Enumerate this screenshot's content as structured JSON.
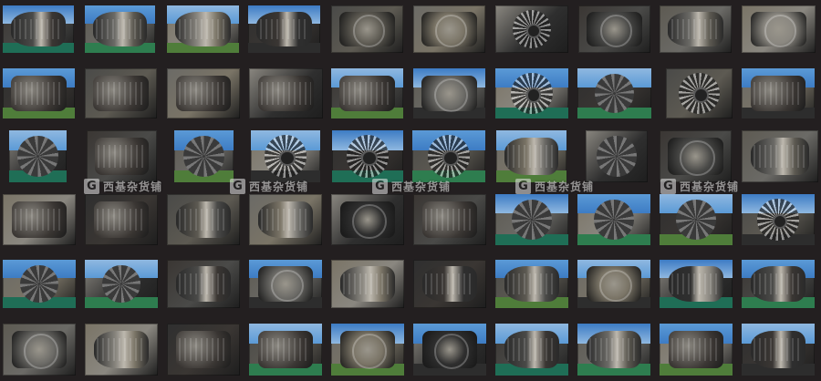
{
  "watermark": {
    "logo_letter": "G",
    "text": "西基杂货铺"
  },
  "palette": {
    "background": "#231f20",
    "sky": [
      "#3d7cc4",
      "#5b9ad6",
      "#8fb8e0"
    ],
    "metal": [
      "#4a4a48",
      "#6b6a66",
      "#8a8780",
      "#3a3633",
      "#5d5a52",
      "#7a7466",
      "#2f2f2f"
    ],
    "ground": [
      "#1f6e56",
      "#2e7d4f",
      "#4f7d3a",
      "#2d2d2d"
    ]
  },
  "rows": [
    [
      {
        "icon": "jet-engine-icon",
        "sky": true
      },
      {
        "icon": "jet-engine-icon",
        "sky": true
      },
      {
        "icon": "jet-engine-icon",
        "sky": true
      },
      {
        "icon": "jet-engine-icon",
        "sky": true
      },
      {
        "icon": "engine-closeup-icon",
        "sky": false
      },
      {
        "icon": "engine-closeup-icon",
        "sky": false
      },
      {
        "icon": "turbine-front-icon",
        "sky": false
      },
      {
        "icon": "engine-closeup-icon",
        "sky": false
      },
      {
        "icon": "jet-engine-icon",
        "sky": false
      },
      {
        "icon": "engine-closeup-icon",
        "sky": false
      }
    ],
    [
      {
        "icon": "piston-engine-icon",
        "sky": true
      },
      {
        "icon": "piston-engine-icon",
        "sky": false
      },
      {
        "icon": "piston-engine-icon",
        "sky": false
      },
      {
        "icon": "piston-engine-icon",
        "sky": false
      },
      {
        "icon": "piston-engine-icon",
        "sky": true
      },
      {
        "icon": "engine-closeup-icon",
        "sky": true
      },
      {
        "icon": "turbine-front-icon",
        "sky": true
      },
      {
        "icon": "radial-engine-icon",
        "sky": true
      },
      {
        "icon": "turbine-front-icon",
        "sky": false
      },
      {
        "icon": "piston-engine-icon",
        "sky": true
      }
    ],
    [
      {
        "icon": "radial-engine-icon",
        "sky": true
      },
      {
        "icon": "piston-engine-icon",
        "sky": false
      },
      {
        "icon": "radial-engine-icon",
        "sky": true
      },
      {
        "icon": "turbine-front-icon",
        "sky": true
      },
      {
        "icon": "turbine-front-icon",
        "sky": true
      },
      {
        "icon": "turbine-front-icon",
        "sky": true
      },
      {
        "icon": "jet-engine-icon",
        "sky": true
      },
      {
        "icon": "radial-engine-icon",
        "sky": false
      },
      {
        "icon": "engine-closeup-icon",
        "sky": false
      },
      {
        "icon": "jet-engine-icon",
        "sky": false
      }
    ],
    [
      {
        "icon": "piston-engine-icon",
        "sky": false
      },
      {
        "icon": "piston-engine-icon",
        "sky": false
      },
      {
        "icon": "jet-engine-icon",
        "sky": false
      },
      {
        "icon": "jet-engine-icon",
        "sky": false
      },
      {
        "icon": "engine-closeup-icon",
        "sky": false
      },
      {
        "icon": "piston-engine-icon",
        "sky": false
      },
      {
        "icon": "radial-engine-icon",
        "sky": true
      },
      {
        "icon": "radial-engine-icon",
        "sky": true
      },
      {
        "icon": "radial-engine-icon",
        "sky": true
      },
      {
        "icon": "turbine-front-icon",
        "sky": true
      }
    ],
    [
      {
        "icon": "radial-engine-icon",
        "sky": true
      },
      {
        "icon": "radial-engine-icon",
        "sky": true
      },
      {
        "icon": "jet-engine-icon",
        "sky": false
      },
      {
        "icon": "engine-closeup-icon",
        "sky": true
      },
      {
        "icon": "jet-engine-icon",
        "sky": false
      },
      {
        "icon": "jet-engine-icon",
        "sky": false
      },
      {
        "icon": "jet-engine-icon",
        "sky": true
      },
      {
        "icon": "engine-closeup-icon",
        "sky": true
      },
      {
        "icon": "jet-engine-icon",
        "sky": true
      },
      {
        "icon": "jet-engine-icon",
        "sky": true
      }
    ],
    [
      {
        "icon": "engine-closeup-icon",
        "sky": false
      },
      {
        "icon": "jet-engine-icon",
        "sky": false
      },
      {
        "icon": "piston-engine-icon",
        "sky": false
      },
      {
        "icon": "piston-engine-icon",
        "sky": true
      },
      {
        "icon": "engine-closeup-icon",
        "sky": true
      },
      {
        "icon": "engine-closeup-icon",
        "sky": true
      },
      {
        "icon": "jet-engine-icon",
        "sky": true
      },
      {
        "icon": "jet-engine-icon",
        "sky": true
      },
      {
        "icon": "piston-engine-icon",
        "sky": true
      },
      {
        "icon": "jet-engine-icon",
        "sky": true
      }
    ]
  ]
}
